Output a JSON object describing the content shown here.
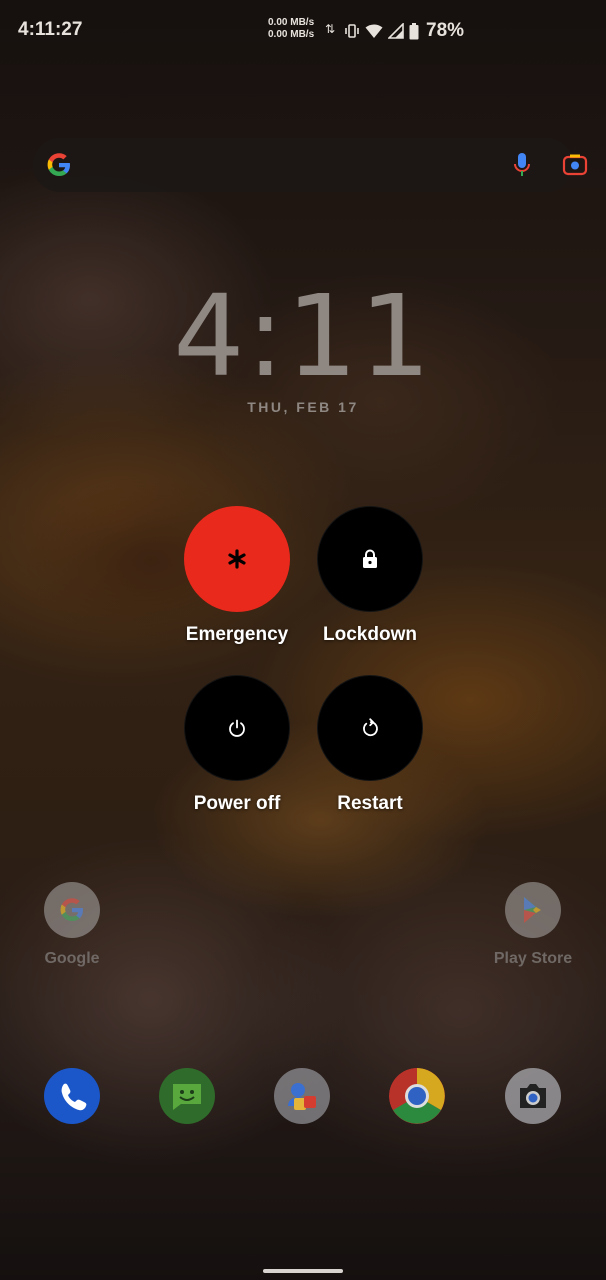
{
  "status_bar": {
    "time": "4:11:27",
    "net_speed_up": "0.00 MB/s",
    "net_speed_down": "0.00 MB/s",
    "battery_percent": "78%",
    "icons": [
      "data-arrows-icon",
      "vibrate-icon",
      "wifi-icon",
      "signal-icon",
      "battery-icon"
    ]
  },
  "search": {
    "icons": [
      "google-logo-icon",
      "mic-icon",
      "lens-icon"
    ],
    "colors": {
      "blue": "#4285F4",
      "red": "#EA4335",
      "yellow": "#FBBC05",
      "green": "#34A853"
    }
  },
  "clock": {
    "time": "4:11",
    "date": "THU, FEB 17"
  },
  "power_menu": {
    "items": [
      {
        "label": "Emergency",
        "icon": "asterisk-icon",
        "color": "#E8291C"
      },
      {
        "label": "Lockdown",
        "icon": "lock-icon",
        "color": "#000000"
      },
      {
        "label": "Power off",
        "icon": "power-icon",
        "color": "#000000"
      },
      {
        "label": "Restart",
        "icon": "restart-icon",
        "color": "#000000"
      }
    ]
  },
  "home_apps": [
    {
      "label": "Google",
      "icon": "google-icon"
    },
    {
      "label": "Play Store",
      "icon": "play-store-icon"
    }
  ],
  "dock": [
    {
      "icon": "phone-icon"
    },
    {
      "icon": "messages-icon"
    },
    {
      "icon": "contacts-icon"
    },
    {
      "icon": "chrome-icon"
    },
    {
      "icon": "camera-icon"
    }
  ]
}
